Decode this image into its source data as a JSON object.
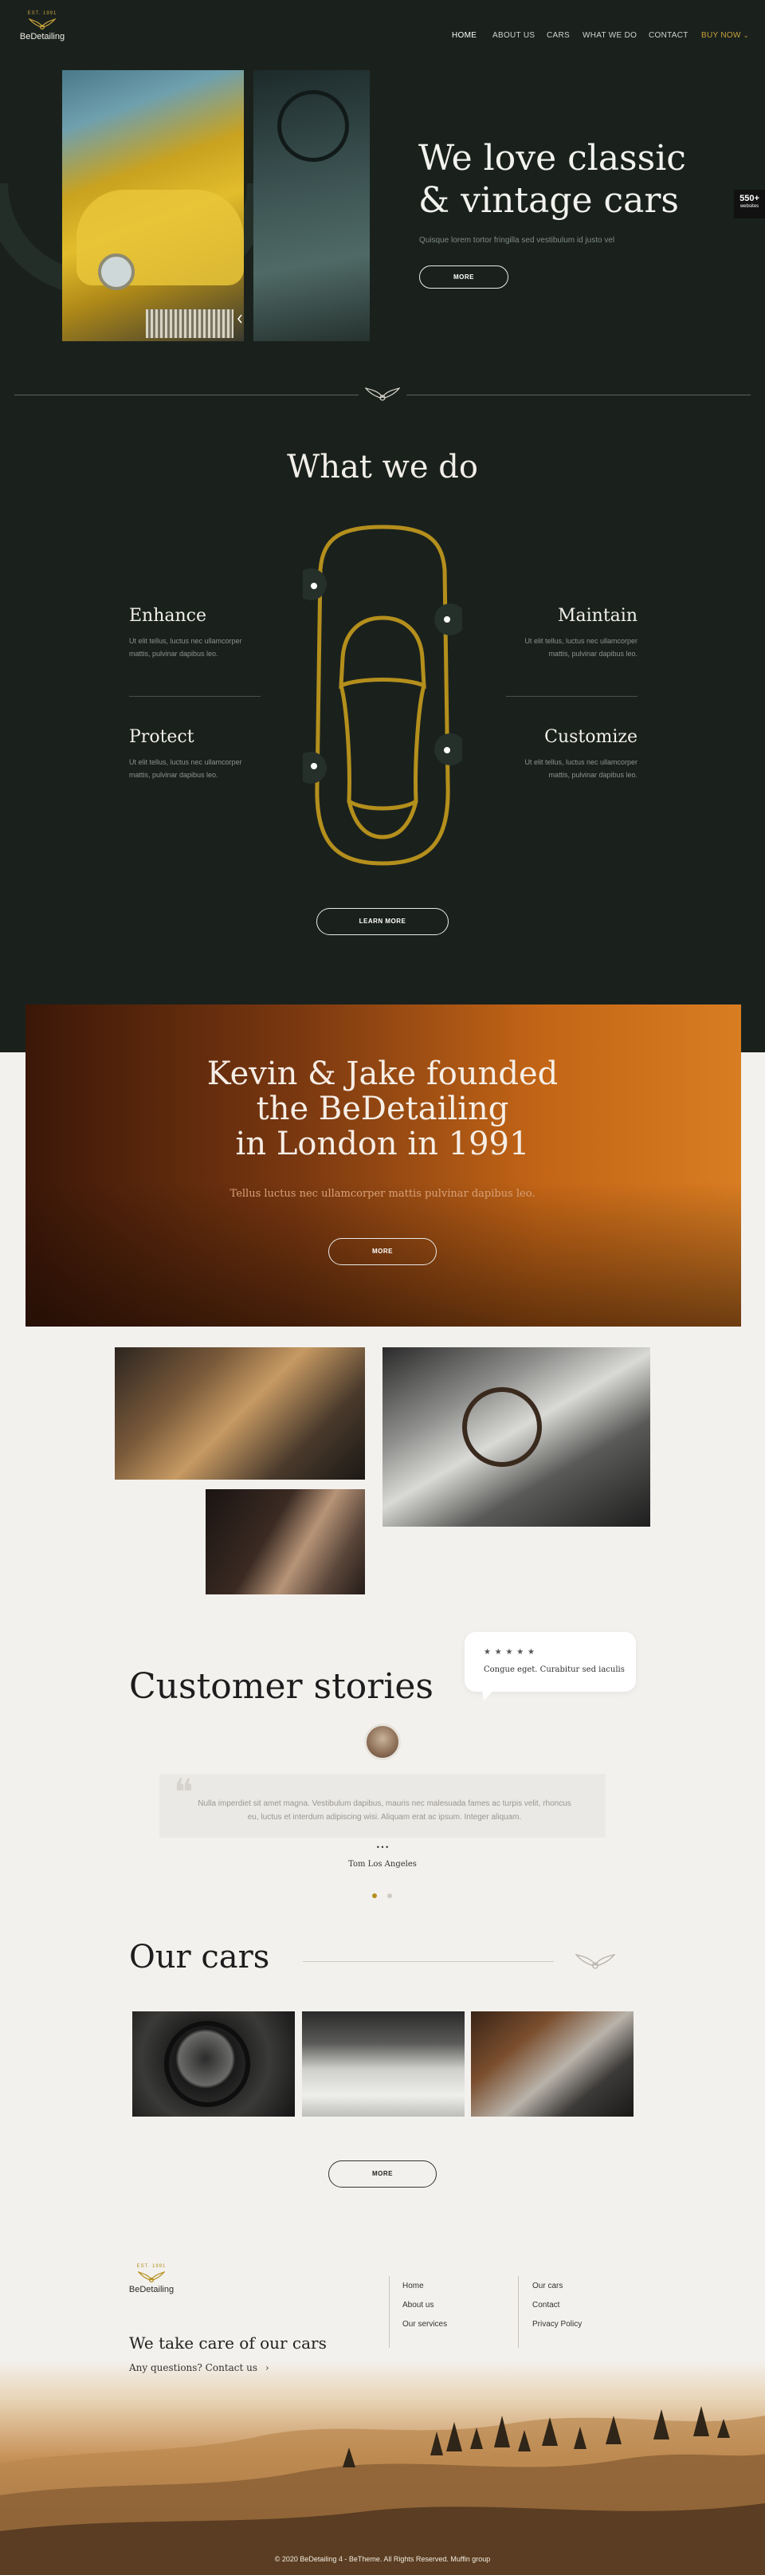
{
  "logo": {
    "est": "EST. 1991",
    "name": "BeDetailing"
  },
  "nav": {
    "home": "HOME",
    "about": "ABOUT US",
    "cars": "CARS",
    "what_we_do": "WHAT WE DO",
    "contact": "CONTACT",
    "buy_now": "BUY NOW"
  },
  "badge": {
    "count": "550+",
    "label": "websites"
  },
  "hero": {
    "title_line1": "We love classic",
    "title_line2": "& vintage cars",
    "subtitle": "Quisque lorem tortor fringilla sed vestibulum id justo vel",
    "button": "MORE"
  },
  "what_we_do": {
    "title": "What we do",
    "services": [
      {
        "title": "Enhance",
        "text_line1": "Ut elit tellus, luctus nec ullamcorper",
        "text_line2": "mattis, pulvinar dapibus leo."
      },
      {
        "title": "Maintain",
        "text_line1": "Ut elit tellus, luctus nec ullamcorper",
        "text_line2": "mattis, pulvinar dapibus leo."
      },
      {
        "title": "Protect",
        "text_line1": "Ut elit tellus, luctus nec ullamcorper",
        "text_line2": "mattis, pulvinar dapibus leo."
      },
      {
        "title": "Customize",
        "text_line1": "Ut elit tellus, luctus nec ullamcorper",
        "text_line2": "mattis, pulvinar dapibus leo."
      }
    ],
    "button": "LEARN MORE"
  },
  "banner": {
    "line1": "Kevin & Jake founded",
    "line2": "the BeDetailing",
    "line3": "in London in 1991",
    "subtitle": "Tellus luctus nec ullamcorper mattis pulvinar dapibus leo.",
    "button": "MORE"
  },
  "stories": {
    "title": "Customer stories",
    "review_stars": "★ ★ ★ ★ ★",
    "review_text": "Congue eget. Curabitur sed iaculis",
    "quote_line1": "Nulla imperdiet sit amet magna. Vestibulum dapibus, mauris nec malesuada fames ac turpis velit, rhoncus",
    "quote_line2": "eu, luctus et interdum adipiscing wisi. Aliquam erat ac ipsum. Integer aliquam.",
    "ellipsis": "• • •",
    "author": "Tom Los Angeles"
  },
  "cars": {
    "title": "Our cars",
    "button": "MORE"
  },
  "footer": {
    "tagline": "We take care of our cars",
    "question": "Any questions? Contact us",
    "links_col1": [
      "Home",
      "About us",
      "Our services"
    ],
    "links_col2": [
      "Our cars",
      "Contact",
      "Privacy Policy"
    ],
    "copyright": "© 2020 BeDetailing 4 - BeTheme. All Rights Reserved. Muffin group"
  },
  "colors": {
    "dark_bg": "#1a211d",
    "gold": "#b48f1c",
    "accent_buy": "#c7a23b",
    "light_bg": "#f3f1ee"
  }
}
